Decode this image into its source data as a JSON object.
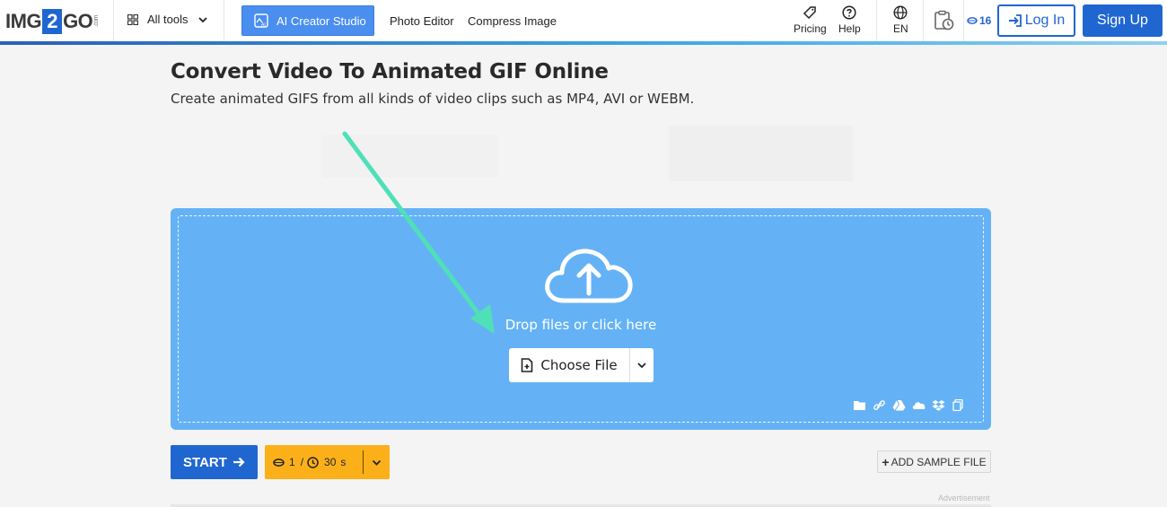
{
  "header": {
    "logo": {
      "left": "IMG",
      "mid": "2",
      "right": "GO",
      "suffix": ".com"
    },
    "all_tools": "All tools",
    "ai_creator": "AI Creator Studio",
    "nav": [
      "Photo Editor",
      "Compress Image"
    ],
    "pricing": "Pricing",
    "help": "Help",
    "language": "EN",
    "credits": "16",
    "login": "Log In",
    "signup": "Sign Up"
  },
  "main": {
    "title": "Convert Video To Animated GIF Online",
    "subtitle": "Create animated GIFS from all kinds of video clips such as MP4, AVI or WEBM."
  },
  "upload": {
    "drop_text": "Drop files or click here",
    "choose_file": "Choose File",
    "sources": [
      "folder-icon",
      "link-icon",
      "google-drive-icon",
      "onedrive-icon",
      "dropbox-icon",
      "clipboard-icon"
    ]
  },
  "controls": {
    "start": "START",
    "credit_cost": "1",
    "separator": "/",
    "duration": "30",
    "duration_unit": "s",
    "add_sample": "ADD SAMPLE FILE",
    "advertisement": "Advertisement"
  },
  "colors": {
    "brand_blue": "#1f66d1",
    "upload_bg": "#64b2f5",
    "credits_orange": "#fbb01a",
    "arrow": "#4fe0b8"
  }
}
